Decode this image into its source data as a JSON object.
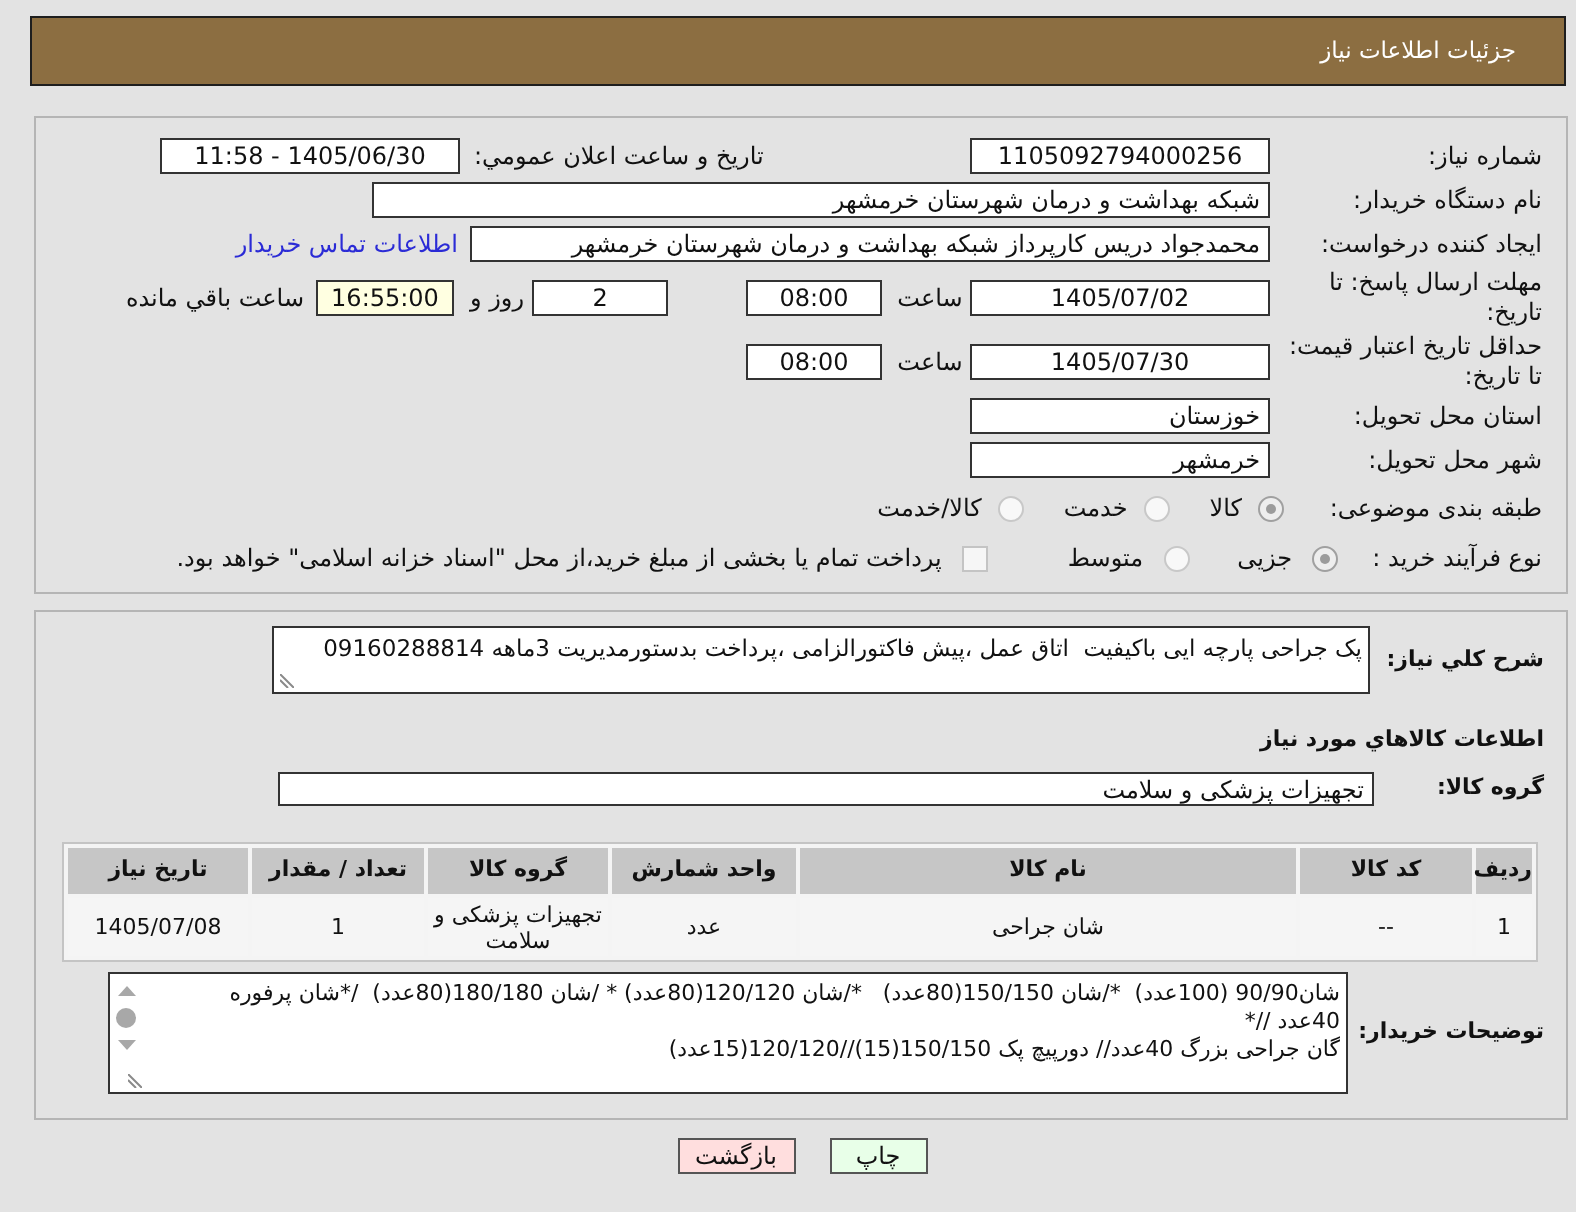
{
  "header": {
    "title": "جزئیات اطلاعات نیاز"
  },
  "details": {
    "need_number": {
      "label": "شماره نیاز:",
      "value": "1105092794000256"
    },
    "announce_date": {
      "label": "تاریخ و ساعت اعلان عمومي:",
      "value": "1405/06/30 - 11:58"
    },
    "buyer_org": {
      "label": "نام دستگاه خریدار:",
      "value": "شبکه بهداشت و درمان شهرستان خرمشهر"
    },
    "requester": {
      "label": "ایجاد کننده درخواست:",
      "value": "محمدجواد دریس کارپرداز شبکه بهداشت و درمان شهرستان خرمشهر",
      "contact_link": "اطلاعات تماس خریدار"
    },
    "reply_deadline": {
      "label": "مهلت ارسال پاسخ: تا تاریخ:",
      "date": "1405/07/02",
      "time_label": "ساعت",
      "time": "08:00",
      "days": "2",
      "days_label": "روز و",
      "remaining": "16:55:00",
      "remaining_label": "ساعت باقي مانده"
    },
    "price_validity": {
      "label": "حداقل تاریخ اعتبار قیمت: تا تاریخ:",
      "date": "1405/07/30",
      "time_label": "ساعت",
      "time": "08:00"
    },
    "province": {
      "label": "استان محل تحویل:",
      "value": "خوزستان"
    },
    "city": {
      "label": "شهر محل تحویل:",
      "value": "خرمشهر"
    },
    "category": {
      "label": "طبقه بندی موضوعی:",
      "options": [
        {
          "label": "کالا",
          "selected": true
        },
        {
          "label": "خدمت",
          "selected": false
        },
        {
          "label": "کالا/خدمت",
          "selected": false
        }
      ]
    },
    "purchase_type": {
      "label": "نوع فرآیند خرید :",
      "options": [
        {
          "label": "جزیی",
          "selected": true
        },
        {
          "label": "متوسط",
          "selected": false
        }
      ],
      "treasury": {
        "label": "پرداخت تمام یا بخشی از مبلغ خرید،از محل \"اسناد خزانه اسلامی\" خواهد بود.",
        "checked": false
      }
    }
  },
  "goods": {
    "description": {
      "label": "شرح کلي نیاز:",
      "value": "پک جراحی پارچه ایی باکیفیت  اتاق عمل ،پیش فاکتورالزامی ،پرداخت بدستورمدیریت 3ماهه 09160288814"
    },
    "title": "اطلاعات کالاهاي مورد نیاز",
    "group": {
      "label": "گروه کالا:",
      "value": "تجهیزات پزشکی و سلامت"
    },
    "table": {
      "columns": [
        "ردیف",
        "کد کالا",
        "نام کالا",
        "واحد شمارش",
        "گروه کالا",
        "تعداد / مقدار",
        "تاریخ نیاز"
      ],
      "rows": [
        [
          "1",
          "--",
          "شان جراحی",
          "عدد",
          "تجهیزات پزشکی و سلامت",
          "1",
          "1405/07/08"
        ]
      ]
    },
    "buyer_notes": {
      "label": "توضیحات خریدار:",
      "lines": [
        "شان90/90 (100عدد)  */شان 150/150(80عدد)   */شان 120/120(80عدد) * /شان 180/180(80عدد)  /*شان پرفوره",
        "40عدد //*",
        "گان جراحی بزرگ 40عدد// دورپیچ پک 150/150(15)//120/120(15عدد)"
      ]
    }
  },
  "buttons": [
    {
      "label": "چاپ",
      "kind": "print"
    },
    {
      "label": "بازگشت",
      "kind": "back"
    }
  ]
}
